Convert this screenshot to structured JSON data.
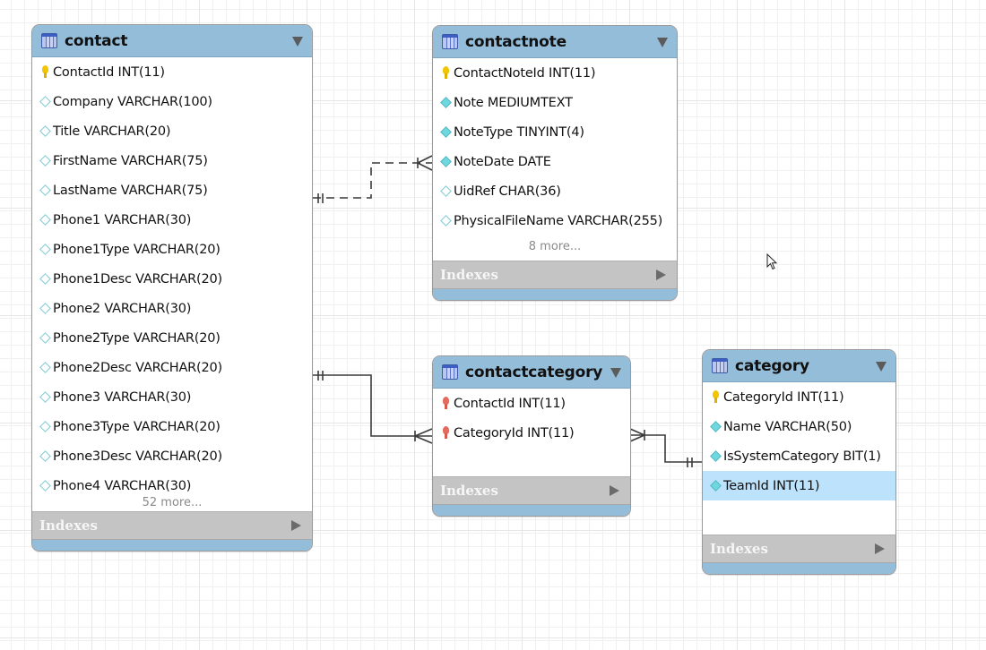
{
  "diagram_type": "EER diagram",
  "tables": {
    "contact": {
      "name": "contact",
      "columns": [
        {
          "label": "ContactId INT(11)",
          "kind": "primary-key"
        },
        {
          "label": "Company VARCHAR(100)",
          "kind": "nullable"
        },
        {
          "label": "Title VARCHAR(20)",
          "kind": "nullable"
        },
        {
          "label": "FirstName VARCHAR(75)",
          "kind": "nullable"
        },
        {
          "label": "LastName VARCHAR(75)",
          "kind": "nullable"
        },
        {
          "label": "Phone1 VARCHAR(30)",
          "kind": "nullable"
        },
        {
          "label": "Phone1Type VARCHAR(20)",
          "kind": "nullable"
        },
        {
          "label": "Phone1Desc VARCHAR(20)",
          "kind": "nullable"
        },
        {
          "label": "Phone2 VARCHAR(30)",
          "kind": "nullable"
        },
        {
          "label": "Phone2Type VARCHAR(20)",
          "kind": "nullable"
        },
        {
          "label": "Phone2Desc VARCHAR(20)",
          "kind": "nullable"
        },
        {
          "label": "Phone3 VARCHAR(30)",
          "kind": "nullable"
        },
        {
          "label": "Phone3Type VARCHAR(20)",
          "kind": "nullable"
        },
        {
          "label": "Phone3Desc VARCHAR(20)",
          "kind": "nullable"
        },
        {
          "label": "Phone4 VARCHAR(30)",
          "kind": "nullable"
        }
      ],
      "more": "52 more...",
      "indexes_label": "Indexes"
    },
    "contactnote": {
      "name": "contactnote",
      "columns": [
        {
          "label": "ContactNoteId INT(11)",
          "kind": "primary-key"
        },
        {
          "label": "Note MEDIUMTEXT",
          "kind": "not-null"
        },
        {
          "label": "NoteType TINYINT(4)",
          "kind": "not-null"
        },
        {
          "label": "NoteDate DATE",
          "kind": "not-null"
        },
        {
          "label": "UidRef CHAR(36)",
          "kind": "nullable"
        },
        {
          "label": "PhysicalFileName VARCHAR(255)",
          "kind": "nullable"
        }
      ],
      "more": "8 more...",
      "indexes_label": "Indexes"
    },
    "contactcategory": {
      "name": "contactcategory",
      "columns": [
        {
          "label": "ContactId INT(11)",
          "kind": "foreign-primary-key"
        },
        {
          "label": "CategoryId INT(11)",
          "kind": "foreign-primary-key"
        }
      ],
      "indexes_label": "Indexes"
    },
    "category": {
      "name": "category",
      "columns": [
        {
          "label": "CategoryId INT(11)",
          "kind": "primary-key"
        },
        {
          "label": "Name VARCHAR(50)",
          "kind": "not-null"
        },
        {
          "label": "IsSystemCategory BIT(1)",
          "kind": "not-null"
        },
        {
          "label": "TeamId INT(11)",
          "kind": "not-null",
          "selected": true
        }
      ],
      "indexes_label": "Indexes"
    }
  },
  "relationships": [
    {
      "from": "contact",
      "to": "contactnote",
      "from_cardinality": "one-and-only-one",
      "to_cardinality": "one-or-many",
      "identifying": false,
      "line": "dashed"
    },
    {
      "from": "contact",
      "to": "contactcategory",
      "from_cardinality": "one-and-only-one",
      "to_cardinality": "one-or-many",
      "identifying": true,
      "line": "solid"
    },
    {
      "from": "category",
      "to": "contactcategory",
      "from_cardinality": "one-and-only-one",
      "to_cardinality": "one-or-many",
      "identifying": true,
      "line": "solid"
    }
  ],
  "colors": {
    "header": "#94bdd9",
    "indexes_bar": "#c4c4c4",
    "selected_row": "#bde2fb",
    "primary_key": "#f2c500",
    "foreign_key": "#e36a5c",
    "not_null": "#6fd7df"
  }
}
